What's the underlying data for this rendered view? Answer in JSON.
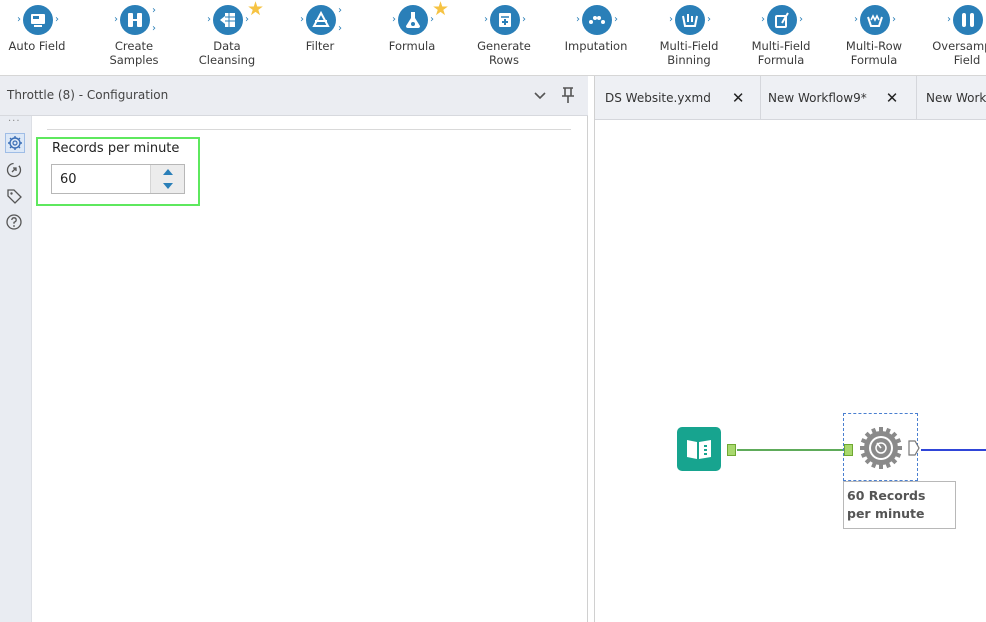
{
  "toolbar": {
    "tools": [
      {
        "label": "Auto Field",
        "icon": "auto-field-icon",
        "starred": false
      },
      {
        "label": "Create\nSamples",
        "icon": "create-samples-icon",
        "starred": false
      },
      {
        "label": "Data\nCleansing",
        "icon": "data-cleansing-icon",
        "starred": true
      },
      {
        "label": "Filter",
        "icon": "filter-icon",
        "starred": false
      },
      {
        "label": "Formula",
        "icon": "formula-icon",
        "starred": true
      },
      {
        "label": "Generate\nRows",
        "icon": "generate-rows-icon",
        "starred": false
      },
      {
        "label": "Imputation",
        "icon": "imputation-icon",
        "starred": false
      },
      {
        "label": "Multi-Field\nBinning",
        "icon": "multi-field-binning-icon",
        "starred": false
      },
      {
        "label": "Multi-Field\nFormula",
        "icon": "multi-field-formula-icon",
        "starred": false
      },
      {
        "label": "Multi-Row\nFormula",
        "icon": "multi-row-formula-icon",
        "starred": false
      },
      {
        "label": "Oversample\nField",
        "icon": "oversample-field-icon",
        "starred": false
      }
    ]
  },
  "config_panel": {
    "title": "Throttle (8) - Configuration",
    "collapse_icon": "chevron-down-icon",
    "pin_icon": "pin-icon",
    "rail_icons": [
      "gear-icon",
      "anchor-icon",
      "tag-icon",
      "help-icon"
    ],
    "records_label": "Records per minute",
    "records_value": "60"
  },
  "workspace": {
    "tabs": [
      {
        "label": "DS Website.yxmd",
        "closable": true
      },
      {
        "label": "New Workflow9*",
        "closable": true
      },
      {
        "label": "New Workflow",
        "closable": false
      }
    ],
    "close_glyph": "✕",
    "annotation": "60 Records per minute"
  },
  "colors": {
    "tool_blue": "#2a7fb8",
    "highlight_green": "#5ee85e",
    "input_node": "#17a48f",
    "conn_green": "#5eab5a",
    "conn_blue": "#2f45d8"
  }
}
